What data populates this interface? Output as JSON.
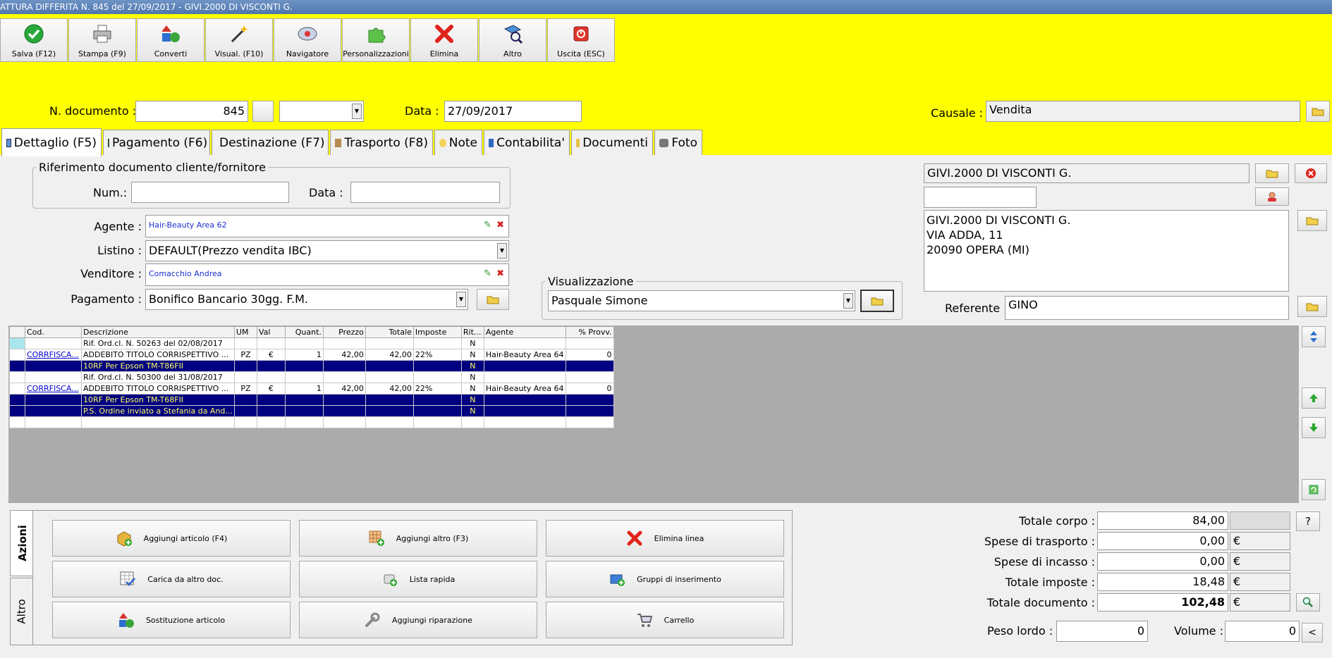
{
  "window": {
    "title": "ATTURA DIFFERITA N. 845 del 27/09/2017 - GIVI.2000 DI VISCONTI G."
  },
  "toolbar": [
    {
      "label": "Salva (F12)",
      "icon": "check-icon"
    },
    {
      "label": "Stampa (F9)",
      "icon": "printer-icon"
    },
    {
      "label": "Converti",
      "icon": "convert-icon"
    },
    {
      "label": "Visual. (F10)",
      "icon": "magic-wand-icon"
    },
    {
      "label": "Navigatore",
      "icon": "navigator-icon"
    },
    {
      "label": "Personalizzazioni",
      "icon": "puzzle-icon"
    },
    {
      "label": "Elimina",
      "icon": "delete-x-icon"
    },
    {
      "label": "Altro",
      "icon": "search-doc-icon"
    },
    {
      "label": "Uscita (ESC)",
      "icon": "exit-icon"
    }
  ],
  "header": {
    "ndoc_label": "N. documento :",
    "ndoc_value": "845",
    "data_label": "Data :",
    "data_value": "27/09/2017",
    "causale_label": "Causale :",
    "causale_value": "Vendita"
  },
  "tabs": [
    {
      "label": "Dettaglio (F5)",
      "selected": true
    },
    {
      "label": "Pagamento (F6)"
    },
    {
      "label": "Destinazione (F7)"
    },
    {
      "label": "Trasporto (F8)"
    },
    {
      "label": "Note"
    },
    {
      "label": "Contabilita'"
    },
    {
      "label": "Documenti"
    },
    {
      "label": "Foto"
    }
  ],
  "riferimento": {
    "legend": "Riferimento documento cliente/fornitore",
    "num_label": "Num.:",
    "num_value": "",
    "data_label": "Data :",
    "data_value": ""
  },
  "form": {
    "agente_label": "Agente :",
    "agente_value": "Hair-Beauty Area 62",
    "listino_label": "Listino :",
    "listino_value": "DEFAULT(Prezzo vendita IBC)",
    "venditore_label": "Venditore :",
    "venditore_value": "Comacchio Andrea",
    "pagamento_label": "Pagamento :",
    "pagamento_value": "Bonifico Bancario 30gg. F.M."
  },
  "visualizzazione": {
    "legend": "Visualizzazione",
    "value": "Pasquale Simone"
  },
  "cliente": {
    "name": "GIVI.2000 DI VISCONTI G.",
    "code": "",
    "address": [
      "GIVI.2000 DI VISCONTI G.",
      "VIA ADDA, 11",
      "20090 OPERA (MI)"
    ],
    "referente_label": "Referente",
    "referente_value": "GINO"
  },
  "grid": {
    "columns": [
      "Cod.",
      "Descrizione",
      "UM",
      "Val",
      "Quant.",
      "Prezzo",
      "Totale",
      "Imposte",
      "Rit...",
      "Agente",
      "% Provv."
    ],
    "rows": [
      {
        "style": "plain",
        "cells": [
          "",
          "Rif. Ord.cl. N. 50263 del 02/08/2017",
          "",
          "",
          "",
          "",
          "",
          "",
          "N",
          "",
          ""
        ]
      },
      {
        "style": "item",
        "cells": [
          "CORRFISCA...",
          "ADDEBITO TITOLO CORRISPETTIVO ...",
          "PZ",
          "€",
          "1",
          "42,00",
          "42,00",
          "22%",
          "N",
          "Hair-Beauty Area 64",
          "0"
        ]
      },
      {
        "style": "hl",
        "cells": [
          "",
          "10RF Per Epson TM-T86FII",
          "",
          "",
          "",
          "",
          "",
          "",
          "N",
          "",
          ""
        ]
      },
      {
        "style": "plain",
        "cells": [
          "",
          "Rif. Ord.cl. N. 50300 del 31/08/2017",
          "",
          "",
          "",
          "",
          "",
          "",
          "N",
          "",
          ""
        ]
      },
      {
        "style": "item",
        "cells": [
          "CORRFISCA...",
          "ADDEBITO TITOLO CORRISPETTIVO ...",
          "PZ",
          "€",
          "1",
          "42,00",
          "42,00",
          "22%",
          "N",
          "Hair-Beauty Area 64",
          "0"
        ]
      },
      {
        "style": "hl",
        "cells": [
          "",
          "10RF Per Epson TM-T68FII",
          "",
          "",
          "",
          "",
          "",
          "",
          "N",
          "",
          ""
        ]
      },
      {
        "style": "hl",
        "cells": [
          "",
          "P.S. Ordine inviato a Stefania da And...",
          "",
          "",
          "",
          "",
          "",
          "",
          "N",
          "",
          ""
        ]
      },
      {
        "style": "plain",
        "cells": [
          "",
          "",
          "",
          "",
          "",
          "",
          "",
          "",
          "",
          "",
          ""
        ]
      }
    ]
  },
  "vtabs": {
    "azioni": "Azioni",
    "altro": "Altro"
  },
  "actions": [
    {
      "label": "Aggiungi articolo (F4)",
      "icon": "add-box-icon"
    },
    {
      "label": "Aggiungi altro (F3)",
      "icon": "add-grid-icon"
    },
    {
      "label": "Elimina linea",
      "icon": "delete-line-icon"
    },
    {
      "label": "Carica da altro doc.",
      "icon": "load-doc-icon"
    },
    {
      "label": "Lista rapida",
      "icon": "quick-list-icon"
    },
    {
      "label": "Gruppi di inserimento",
      "icon": "group-insert-icon"
    },
    {
      "label": "Sostituzione articolo",
      "icon": "replace-item-icon"
    },
    {
      "label": "Aggiungi riparazione",
      "icon": "wrench-icon"
    },
    {
      "label": "Carrello",
      "icon": "cart-icon"
    }
  ],
  "totals": {
    "corpo_label": "Totale corpo :",
    "corpo_value": "84,00",
    "trasporto_label": "Spese di trasporto :",
    "trasporto_value": "0,00",
    "incasso_label": "Spese di incasso :",
    "incasso_value": "0,00",
    "imposte_label": "Totale imposte :",
    "imposte_value": "18,48",
    "documento_label": "Totale documento :",
    "documento_value": "102,48",
    "currency": "€",
    "help": "?",
    "peso_label": "Peso lordo :",
    "peso_value": "0",
    "volume_label": "Volume :",
    "volume_value": "0",
    "volume_btn": "<"
  },
  "colors": {
    "yellow": "#ffff00",
    "highlight_row": "#000080",
    "highlight_text": "#ffff66",
    "link": "#0000cc"
  }
}
